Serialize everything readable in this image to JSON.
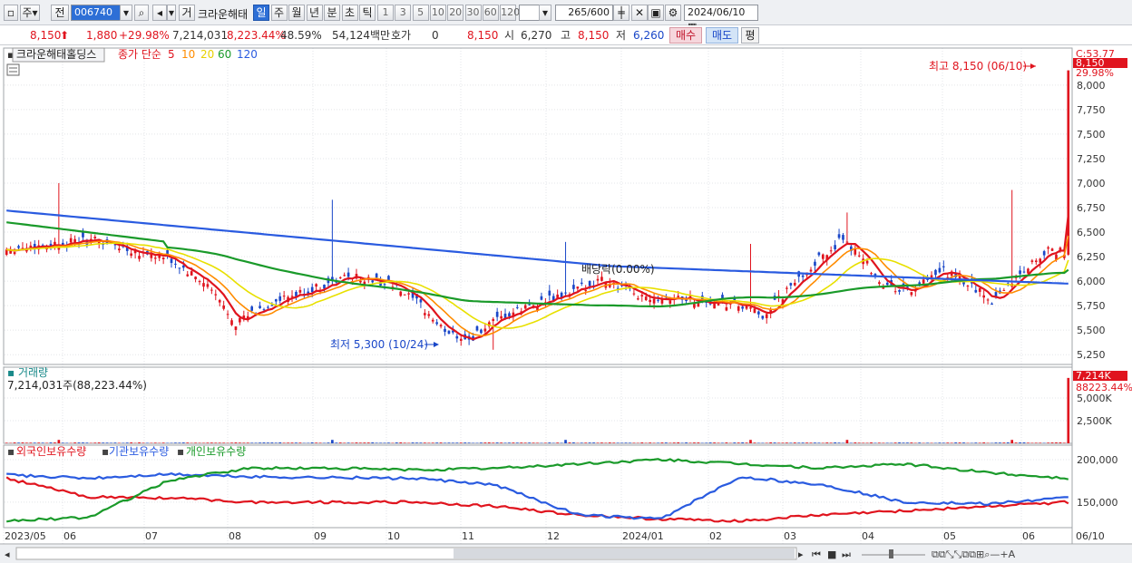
{
  "toolbar": {
    "market_label": "주",
    "prev_label": "전",
    "code": "006740",
    "trade_label": "거",
    "stock_name": "크라운해태",
    "periods": [
      "일",
      "주",
      "월",
      "년",
      "분",
      "초",
      "틱"
    ],
    "active_period": "일",
    "minutes": [
      "1",
      "3",
      "5",
      "10",
      "20",
      "30",
      "60",
      "120"
    ],
    "count": "265",
    "count_total": "/600",
    "date": "2024/06/10"
  },
  "quote": {
    "price": "8,150",
    "change": "1,880",
    "change_pct": "+29.98%",
    "volume": "7,214,031",
    "volume_pct": "8,223.44%",
    "turnover": "48.59%",
    "amount": "54,124백만",
    "hoga_label": "호가",
    "hoga_value": "0",
    "hoga_price": "8,150",
    "open_label": "시",
    "open": "6,270",
    "high_label": "고",
    "high": "8,150",
    "low_label": "저",
    "low": "6,260",
    "buy_label": "매수",
    "sell_label": "매도",
    "avg_label": "평"
  },
  "price_panel": {
    "name": "크라운해태홀딩스",
    "ma_label": "종가 단순",
    "ma_periods": [
      "5",
      "10",
      "20",
      "60",
      "120"
    ],
    "ma_colors": [
      "#e0141e",
      "#ff8c00",
      "#e8e000",
      "#1a9a2a",
      "#2a5be0"
    ],
    "high_marker": "최고 8,150 (06/10)",
    "low_marker": "최저 5,300 (10/24)",
    "dividend_marker": "배당락(0.00%)",
    "top_label": "C:53.77",
    "last_price_tag": "8,150",
    "last_change_tag": "29.98%",
    "y_ticks": [
      "8,000",
      "7,750",
      "7,500",
      "7,250",
      "7,000",
      "6,750",
      "6,500",
      "6,250",
      "6,000",
      "5,750",
      "5,500",
      "5,250"
    ]
  },
  "volume_panel": {
    "name": "거래량",
    "value_text": "7,214,031주(88,223.44%)",
    "tag_value": "7,214K",
    "tag_pct": "88223.44%",
    "y_ticks": [
      "5,000K",
      "2,500K"
    ]
  },
  "holdings_panel": {
    "foreign": "외국인보유수량",
    "institution": "기관보유수량",
    "individual": "개인보유수량",
    "y_ticks": [
      "200,000",
      "150,000"
    ]
  },
  "x_labels": [
    "2023/05",
    "06",
    "07",
    "08",
    "09",
    "10",
    "11",
    "12",
    "2024/01",
    "02",
    "03",
    "04",
    "05",
    "06",
    "06/10"
  ],
  "chart_data": {
    "type": "candlestick",
    "x": [
      "2023/05",
      "06",
      "07",
      "08",
      "09",
      "10",
      "11",
      "12",
      "2024/01",
      "02",
      "03",
      "04",
      "05",
      "06"
    ],
    "close_approx": [
      6350,
      6450,
      6100,
      5700,
      6050,
      5950,
      5450,
      5900,
      5800,
      5700,
      6050,
      5950,
      6200,
      8150
    ],
    "ylim": [
      5150,
      8350
    ],
    "high": 8150,
    "low": 5300,
    "last": 8150,
    "volume_last": 7214031,
    "series": [
      {
        "name": "외국인보유수량",
        "approx": [
          178000,
          156000,
          155000,
          150000,
          150000,
          150000,
          145000,
          135000,
          130000,
          128000,
          135000,
          140000,
          145000,
          150000
        ]
      },
      {
        "name": "기관보유수량",
        "approx": [
          182000,
          178000,
          183000,
          180000,
          179000,
          178000,
          170000,
          135000,
          130000,
          180000,
          170000,
          150000,
          148000,
          155000
        ]
      },
      {
        "name": "개인보유수량",
        "approx": [
          128000,
          132000,
          176000,
          190000,
          190000,
          188000,
          190000,
          195000,
          200000,
          195000,
          190000,
          195000,
          185000,
          178000
        ]
      }
    ]
  }
}
